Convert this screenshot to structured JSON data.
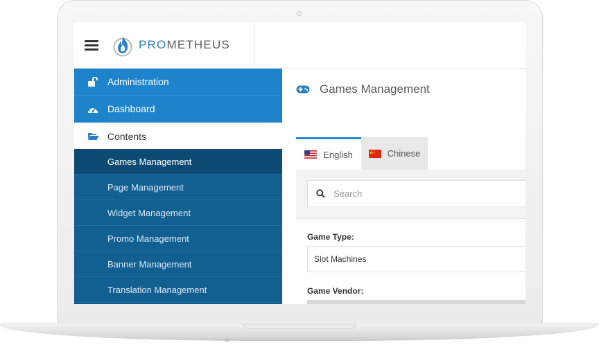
{
  "brand": {
    "prefix": "PRO",
    "suffix": "METHEUS"
  },
  "sidebar": {
    "items": [
      {
        "label": "Administration",
        "icon": "unlock-icon"
      },
      {
        "label": "Dashboard",
        "icon": "dashboard-icon"
      },
      {
        "label": "Contents",
        "icon": "folder-open-icon"
      }
    ],
    "submenu": [
      {
        "label": "Games Management",
        "active": true
      },
      {
        "label": "Page Management"
      },
      {
        "label": "Widget Management"
      },
      {
        "label": "Promo Management"
      },
      {
        "label": "Banner Management"
      },
      {
        "label": "Translation Management"
      }
    ]
  },
  "page": {
    "title": "Games Management",
    "icon": "gamepad-icon"
  },
  "tabs": [
    {
      "label": "English",
      "flag": "us-flag-icon",
      "active": true
    },
    {
      "label": "Chinese",
      "flag": "china-flag-icon",
      "active": false
    }
  ],
  "search": {
    "placeholder": "Search"
  },
  "filters": {
    "game_type_label": "Game Type:",
    "game_type_value": "Slot Machines",
    "game_vendor_label": "Game Vendor:"
  },
  "colors": {
    "primary": "#1d84cc",
    "submenu": "#125f92",
    "submenu_active": "#0d4a73",
    "accent": "#2b7fc4"
  }
}
